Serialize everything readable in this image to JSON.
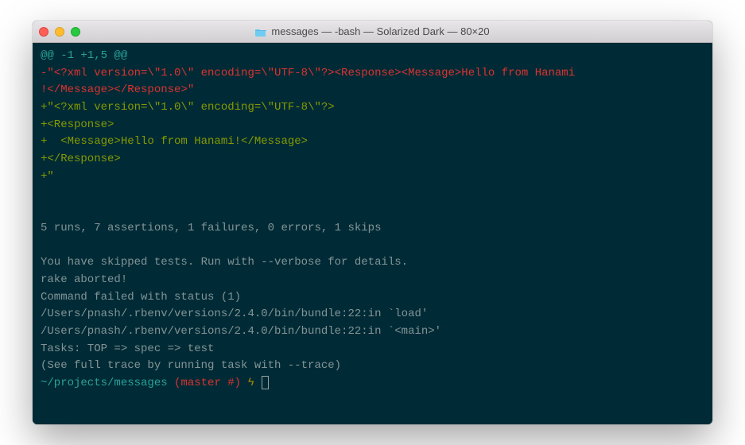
{
  "titlebar": {
    "folder_icon": "messages",
    "title": "messages — -bash — Solarized Dark — 80×20"
  },
  "terminal": {
    "hunk_header": "@@ -1 +1,5 @@",
    "del_line1": "-\"<?xml version=\\\"1.0\\\" encoding=\\\"UTF-8\\\"?><Response><Message>Hello from Hanami",
    "del_line2": "!</Message></Response>\"",
    "add_line1": "+\"<?xml version=\\\"1.0\\\" encoding=\\\"UTF-8\\\"?>",
    "add_line2": "+<Response>",
    "add_line3": "+  <Message>Hello from Hanami!</Message>",
    "add_line4": "+</Response>",
    "add_line5": "+\"",
    "summary": "5 runs, 7 assertions, 1 failures, 0 errors, 1 skips",
    "skip_note": "You have skipped tests. Run with --verbose for details.",
    "rake_abort": "rake aborted!",
    "cmd_failed": "Command failed with status (1)",
    "trace1": "/Users/pnash/.rbenv/versions/2.4.0/bin/bundle:22:in `load'",
    "trace2": "/Users/pnash/.rbenv/versions/2.4.0/bin/bundle:22:in `<main>'",
    "tasks": "Tasks: TOP => spec => test",
    "see_trace": "(See full trace by running task with --trace)",
    "prompt_path": "~/projects/messages",
    "prompt_branch": " (master #)",
    "prompt_bolt": " ϟ "
  }
}
